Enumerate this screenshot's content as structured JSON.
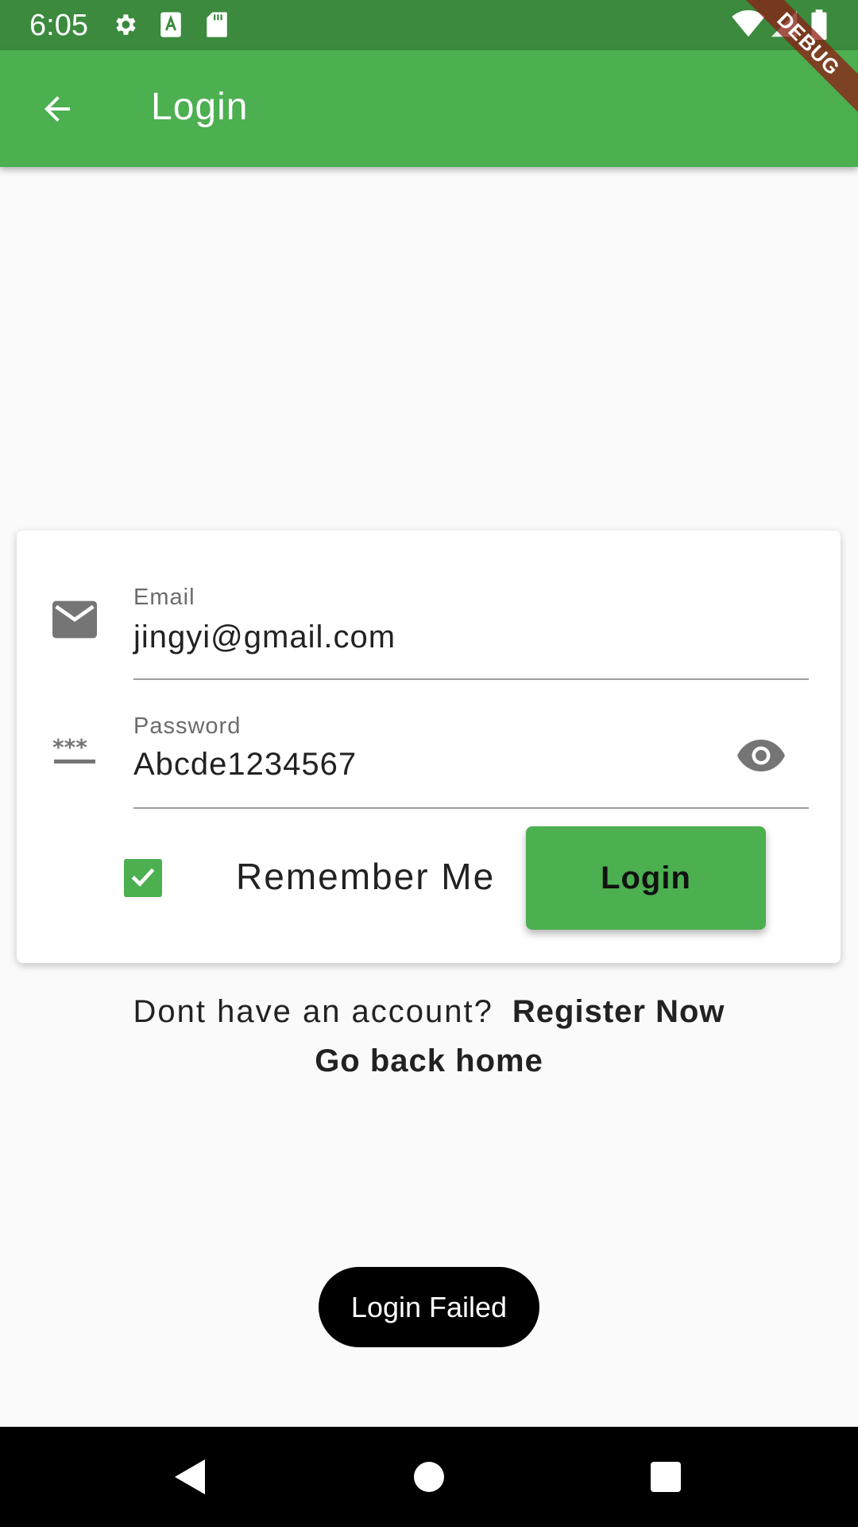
{
  "status_bar": {
    "time": "6:05",
    "icons": [
      "gear-icon",
      "keyboard-a-icon",
      "sd-card-icon",
      "wifi-icon",
      "signal-icon",
      "battery-icon"
    ]
  },
  "app_bar": {
    "title": "Login",
    "back_icon": "arrow-back-icon",
    "color": "#4caf50",
    "debug_banner": "DEBUG"
  },
  "login_form": {
    "email": {
      "label": "Email",
      "value": "jingyi@gmail.com",
      "icon": "mail-icon"
    },
    "password": {
      "label": "Password",
      "value": "Abcde1234567",
      "icon": "password-icon",
      "toggle_icon": "eye-icon"
    },
    "remember_me": {
      "label": "Remember Me",
      "checked": true
    },
    "login_button": "Login"
  },
  "footer": {
    "prompt": "Dont have an account?",
    "register_link": "Register Now",
    "home_link": "Go back home"
  },
  "toast": {
    "message": "Login Failed"
  },
  "nav_bar": {
    "buttons": [
      "back-triangle-icon",
      "home-circle-icon",
      "recents-square-icon"
    ]
  }
}
